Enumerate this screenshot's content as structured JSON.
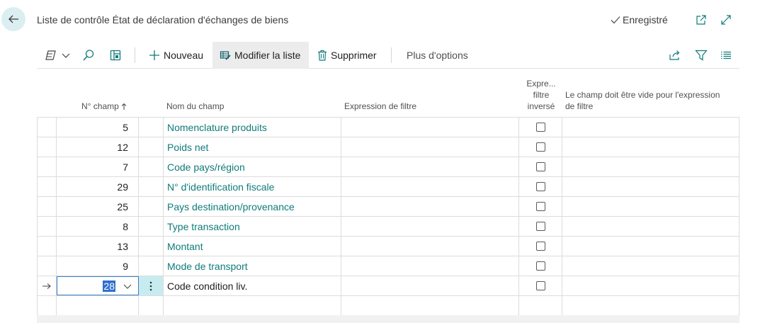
{
  "header": {
    "title": "Liste de contrôle État de déclaration d'échanges de biens",
    "saved_label": "Enregistré"
  },
  "toolbar": {
    "new_label": "Nouveau",
    "edit_list_label": "Modifier la liste",
    "delete_label": "Supprimer",
    "more_label": "Plus d'options"
  },
  "columns": {
    "field_no": "N° champ",
    "field_name": "Nom du champ",
    "filter_expr": "Expression de filtre",
    "inverted_1": "Expre...",
    "inverted_2": "filtre",
    "inverted_3": "inversé",
    "must_empty_1": "Le champ doit être vide pour l'expression",
    "must_empty_2": "de filtre"
  },
  "rows": [
    {
      "no": "5",
      "name": "Nomenclature produits",
      "filter": "",
      "inverted": false
    },
    {
      "no": "12",
      "name": "Poids net",
      "filter": "",
      "inverted": false
    },
    {
      "no": "7",
      "name": "Code pays/région",
      "filter": "",
      "inverted": false
    },
    {
      "no": "29",
      "name": "N° d'identification fiscale",
      "filter": "",
      "inverted": false
    },
    {
      "no": "25",
      "name": "Pays destination/provenance",
      "filter": "",
      "inverted": false
    },
    {
      "no": "8",
      "name": "Type transaction",
      "filter": "",
      "inverted": false
    },
    {
      "no": "13",
      "name": "Montant",
      "filter": "",
      "inverted": false
    },
    {
      "no": "9",
      "name": "Mode de transport",
      "filter": "",
      "inverted": false
    },
    {
      "no": "28",
      "name": "Code condition liv.",
      "filter": "",
      "inverted": false
    }
  ],
  "colors": {
    "accent": "#0f7b7a",
    "selection": "#2f6fcf"
  }
}
